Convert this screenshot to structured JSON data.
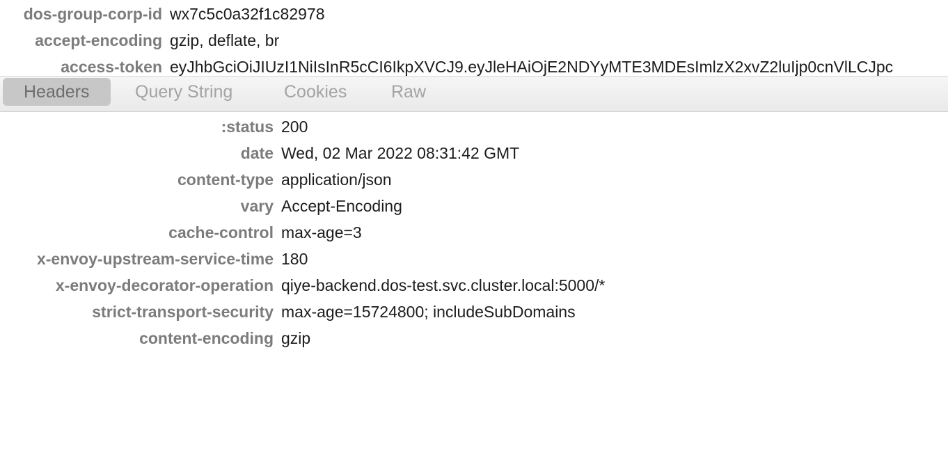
{
  "request_headers": [
    {
      "key": "dos-group-corp-id",
      "value": "wx7c5c0a32f1c82978"
    },
    {
      "key": "accept-encoding",
      "value": "gzip, deflate, br"
    },
    {
      "key": "access-token",
      "value": "eyJhbGciOiJIUzI1NiIsInR5cCI6IkpXVCJ9.eyJleHAiOjE2NDYyMTE3MDEsImlzX2xvZ2luIjp0cnVlLCJpc"
    }
  ],
  "tabs": [
    {
      "label": "Headers",
      "active": true
    },
    {
      "label": "Query String",
      "active": false
    },
    {
      "label": "Cookies",
      "active": false
    },
    {
      "label": "Raw",
      "active": false
    }
  ],
  "response_headers": [
    {
      "key": ":status",
      "value": "200"
    },
    {
      "key": "date",
      "value": "Wed, 02 Mar 2022 08:31:42 GMT"
    },
    {
      "key": "content-type",
      "value": "application/json"
    },
    {
      "key": "vary",
      "value": "Accept-Encoding"
    },
    {
      "key": "cache-control",
      "value": "max-age=3"
    },
    {
      "key": "x-envoy-upstream-service-time",
      "value": "180"
    },
    {
      "key": "x-envoy-decorator-operation",
      "value": "qiye-backend.dos-test.svc.cluster.local:5000/*"
    },
    {
      "key": "strict-transport-security",
      "value": "max-age=15724800; includeSubDomains"
    },
    {
      "key": "content-encoding",
      "value": "gzip"
    }
  ]
}
